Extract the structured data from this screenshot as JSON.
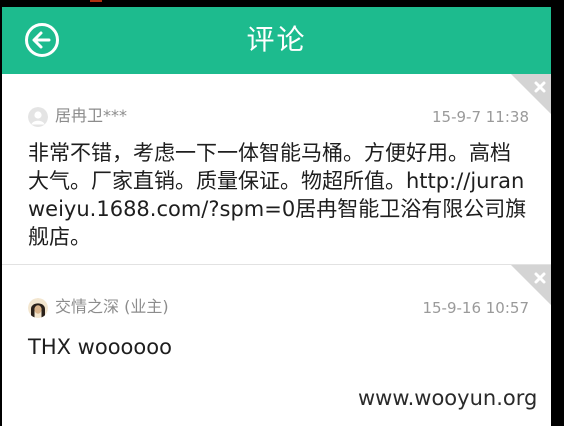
{
  "header": {
    "title": "评论",
    "back_icon": "arrow-left-circle-icon"
  },
  "colors": {
    "header_bg": "#1dbb8e",
    "meta_text": "#8c8c8c",
    "body_text": "#1e1e1e",
    "close_corner": "#d4d4d4"
  },
  "comments": [
    {
      "author": "居冉卫***",
      "time": "15-9-7 11:38",
      "avatar_icon": "default-user-icon",
      "text": "非常不错，考虑一下一体智能马桶。方便好用。高档大气。厂家直销。质量保证。物超所值。http://juranweiyu.1688.com/?spm=0居冉智能卫浴有限公司旗舰店。",
      "close_icon": "close-icon"
    },
    {
      "author": "交情之深  (业主)",
      "time": "15-9-16 10:57",
      "avatar_icon": "user-photo-avatar",
      "text": "THX woooooo",
      "close_icon": "close-icon"
    }
  ],
  "watermark": "www.wooyun.org"
}
